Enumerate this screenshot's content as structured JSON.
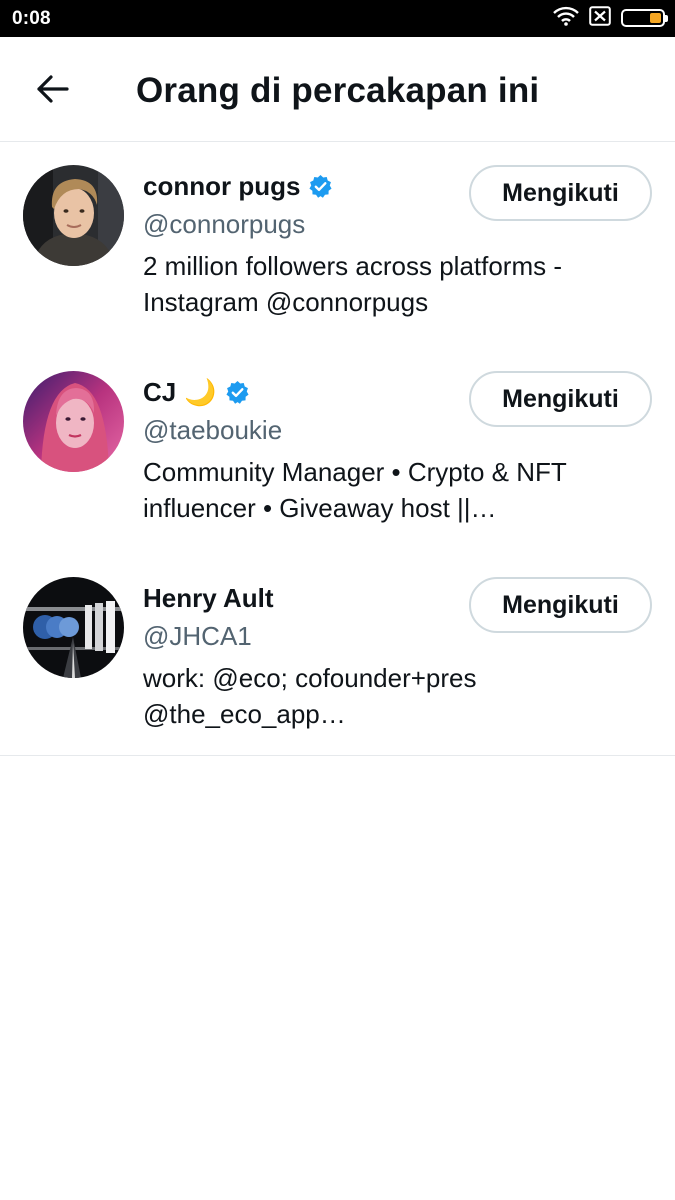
{
  "status_bar": {
    "time": "0:08",
    "battery_level": 0.3,
    "icons": [
      "wifi-icon",
      "sim-x-icon",
      "battery-icon"
    ]
  },
  "header": {
    "title": "Orang di percakapan ini",
    "back_icon": "arrow-left-icon"
  },
  "colors": {
    "verified": "#1d9bf0",
    "handle": "#536471",
    "divider": "#e6e9ec",
    "button_border": "#cfd9de",
    "battery": "#f5a623"
  },
  "users": [
    {
      "name": "connor pugs",
      "emoji": "",
      "verified": true,
      "handle": "@connorpugs",
      "bio_line1": "2 million followers across platforms -",
      "bio_line2": "Instagram @connorpugs",
      "follow_label": "Mengikuti"
    },
    {
      "name": "CJ",
      "emoji": "🌙",
      "verified": true,
      "handle": "@taeboukie",
      "bio_line1": "Community Manager • Crypto & NFT",
      "bio_line2": "influencer • Giveaway host ||…",
      "follow_label": "Mengikuti"
    },
    {
      "name": "Henry Ault",
      "emoji": "",
      "verified": false,
      "handle": "@JHCA1",
      "bio_line1": "work: @eco; cofounder+pres",
      "bio_line2": "@the_eco_app…",
      "follow_label": "Mengikuti"
    }
  ]
}
